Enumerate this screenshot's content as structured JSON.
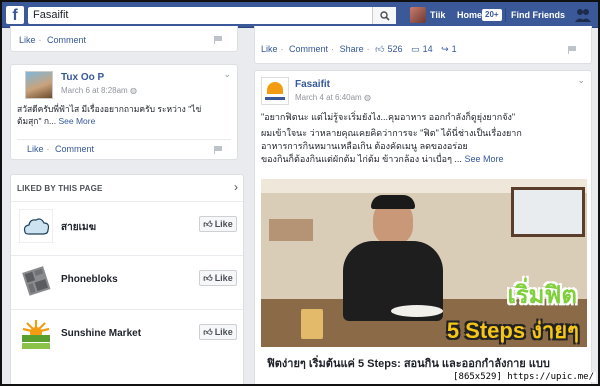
{
  "topbar": {
    "logo": "f",
    "search_value": "Fasaifit",
    "user_name": "Tiik",
    "home_label": "Home",
    "home_badge": "20+",
    "find_friends_label": "Find Friends"
  },
  "left": {
    "top_actions": {
      "like": "Like",
      "comment": "Comment"
    },
    "post": {
      "author": "Tux Oo P",
      "time": "March 6 at 8:28am",
      "text_line1": "สวัสดีครับพี่ฟ้าไส มีเรื่องอยากถามครับ ระหว่าง \"ไข่",
      "text_line2": "ต้มสุก\" ก...",
      "see_more": "See More",
      "like": "Like",
      "comment": "Comment"
    },
    "liked_pages": {
      "header": "LIKED BY THIS PAGE",
      "items": [
        {
          "name": "สายเมฆ",
          "button": "Like"
        },
        {
          "name": "Phonebloks",
          "button": "Like"
        },
        {
          "name": "Sunshine Market",
          "button": "Like"
        }
      ]
    }
  },
  "right": {
    "top_actions": {
      "like": "Like",
      "comment": "Comment",
      "share": "Share",
      "likes": "526",
      "comments": "14",
      "shares": "1"
    },
    "post": {
      "author": "Fasaifit",
      "time": "March 4 at 6:40am",
      "line1": "\"อยากฟิตนะ แต่ไม่รู้จะเริ่มยังไง...คุมอาหาร ออกกำลังก็ดูยุ่งยากจัง\"",
      "line2": "ผมเข้าใจนะ ว่าหลายคุณเคยคิดว่าการจะ \"ฟิต\" ได้นี่ช่างเป็นเรื่องยาก",
      "line3": "อาหารการกินหมานเหลือเกิน ต้องคัดเมนู ลดของอร่อย",
      "line4": "ของกินก็ต้องกินแต่ผักต้ม ไก่ต้ม ข้าวกล้อง น่าเบื่อๆ ...",
      "see_more": "See More",
      "image_title_th": "เริ่มฟิต",
      "image_title_en": "5 Steps ง่ายๆ",
      "link_title": "ฟิตง่ายๆ เริ่มต้นแค่ 5 Steps: สอนกิน และออกกำลังกาย แบบ"
    }
  },
  "watermark": "[865x529] https://upic.me/"
}
